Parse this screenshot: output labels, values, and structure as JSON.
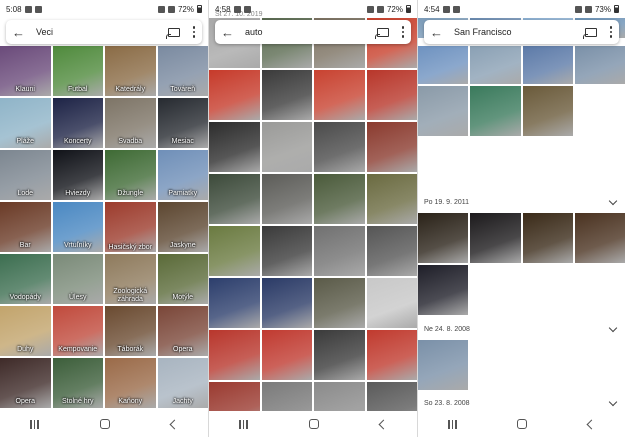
{
  "panels": [
    {
      "status": {
        "time": "5:08",
        "battery": "72%"
      },
      "search": {
        "label": "Veci"
      },
      "tiles": [
        {
          "label": "Klauni",
          "color": "#6a4a7a"
        },
        {
          "label": "Futbal",
          "color": "#4f8a3c"
        },
        {
          "label": "Katedrály",
          "color": "#8a6b45"
        },
        {
          "label": "Továreň",
          "color": "#7a8aa0"
        },
        {
          "label": "Pláže",
          "color": "#8fb4c8"
        },
        {
          "label": "Koncerty",
          "color": "#1d2346"
        },
        {
          "label": "Svadba",
          "color": "#7d7466"
        },
        {
          "label": "Mesiac",
          "color": "#262a30"
        },
        {
          "label": "Lode",
          "color": "#7c8690"
        },
        {
          "label": "Hviezdy",
          "color": "#101218"
        },
        {
          "label": "Džungle",
          "color": "#3e6a34"
        },
        {
          "label": "Pamiatky",
          "color": "#6f8fb8"
        },
        {
          "label": "Bar",
          "color": "#6a3a26"
        },
        {
          "label": "Vrtuľníky",
          "color": "#4a88c2"
        },
        {
          "label": "Hasičský zbor",
          "color": "#9c3b2c"
        },
        {
          "label": "Jaskyne",
          "color": "#5c4630"
        },
        {
          "label": "Vodopády",
          "color": "#3c6e50"
        },
        {
          "label": "Úlesy",
          "color": "#7a8a78"
        },
        {
          "label": "Zoologická záhrada",
          "color": "#8e7a5c"
        },
        {
          "label": "Motýle",
          "color": "#5a6a38"
        },
        {
          "label": "Duhy",
          "color": "#c2a46c"
        },
        {
          "label": "Kempovanie",
          "color": "#c04a3c"
        },
        {
          "label": "Táborák",
          "color": "#6a4a30"
        },
        {
          "label": "Opera",
          "color": "#7a4638"
        },
        {
          "label": "Opera",
          "color": "#3e2a28"
        },
        {
          "label": "Stolné hry",
          "color": "#3c5e3a"
        },
        {
          "label": "Kaňony",
          "color": "#9a6a48"
        },
        {
          "label": "Jachty",
          "color": "#a8b4c0"
        }
      ],
      "nav": {
        "recent": "recent-apps",
        "home": "home",
        "back": "back"
      }
    },
    {
      "status": {
        "time": "4:58",
        "battery": "72%"
      },
      "search": {
        "label": "auto"
      },
      "date_top": "St 27. 10. 2019",
      "tiles": [
        {
          "color": "#a8a8a8"
        },
        {
          "color": "#5a6a50"
        },
        {
          "color": "#7a7060"
        },
        {
          "color": "#c8402c"
        },
        {
          "color": "#c63a2a"
        },
        {
          "color": "#3a3a3a"
        },
        {
          "color": "#c84230"
        },
        {
          "color": "#b8362a"
        },
        {
          "color": "#2c2c2c"
        },
        {
          "color": "#9a9a98"
        },
        {
          "color": "#4a4a4a"
        },
        {
          "color": "#8a3a2e"
        },
        {
          "color": "#3c4a3a"
        },
        {
          "color": "#5c5c58"
        },
        {
          "color": "#4a5a3a"
        },
        {
          "color": "#6a6a40"
        },
        {
          "color": "#6a7a40"
        },
        {
          "color": "#3a3a3a"
        },
        {
          "color": "#707070"
        },
        {
          "color": "#555555"
        },
        {
          "color": "#2c3e6c"
        },
        {
          "color": "#2a3a66"
        },
        {
          "color": "#5a5a48"
        },
        {
          "color": "#c8c8c8"
        },
        {
          "color": "#b8362c"
        },
        {
          "color": "#c03a30"
        },
        {
          "color": "#3a3a3a"
        },
        {
          "color": "#c03a2e"
        },
        {
          "color": "#9a3a30"
        },
        {
          "color": "#7a7a7a"
        },
        {
          "color": "#8a8a8a"
        },
        {
          "color": "#5a5a5a"
        }
      ],
      "nav": {
        "recent": "recent-apps",
        "home": "home",
        "back": "back"
      }
    },
    {
      "status": {
        "time": "4:54",
        "battery": "73%"
      },
      "search": {
        "label": "San Francisco"
      },
      "top_tiles": [
        {
          "color": "#7a9ab8"
        },
        {
          "color": "#6a8ab0"
        },
        {
          "color": "#8aaed0"
        },
        {
          "color": "#6a90b4"
        }
      ],
      "row2_tiles": [
        {
          "color": "#6e92c0"
        },
        {
          "color": "#8aa0b4"
        },
        {
          "color": "#5c7aa8"
        },
        {
          "color": "#7a90a8"
        },
        {
          "color": "#8a9aa8"
        },
        {
          "color": "#3a7a5c"
        },
        {
          "color": "#6a5a3a"
        }
      ],
      "sections": [
        {
          "date": "Po 19. 9. 2011",
          "tiles": [
            {
              "color": "#2a2218"
            },
            {
              "color": "#1c1a1c"
            },
            {
              "color": "#3a2a18"
            },
            {
              "color": "#4a3220"
            },
            {
              "color": "#1e1e28"
            }
          ]
        },
        {
          "date": "Ne 24. 8. 2008",
          "tiles": [
            {
              "color": "#7a90a8"
            }
          ]
        },
        {
          "date": "So 23. 8. 2008",
          "tiles": []
        }
      ],
      "nav": {
        "recent": "recent-apps",
        "home": "home",
        "back": "back"
      }
    }
  ]
}
